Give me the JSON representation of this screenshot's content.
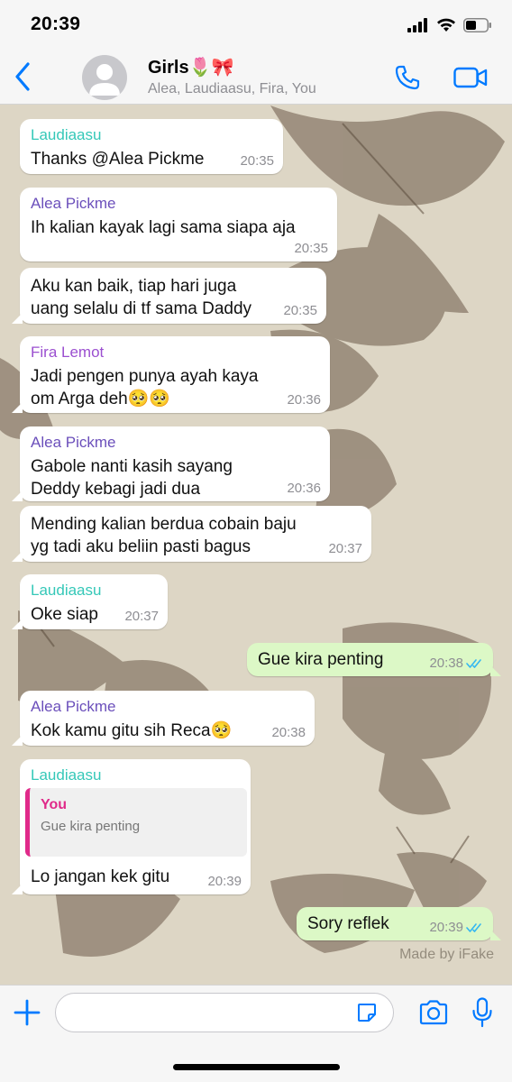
{
  "status_bar": {
    "time": "20:39"
  },
  "header": {
    "title": "Girls🌷🎀",
    "participants": "Alea, Laudiaasu, Fira, You"
  },
  "colors": {
    "accent": "#007aff",
    "sender_laudiaasu": "#35c8b8",
    "sender_alea": "#6b4fbb",
    "sender_fira": "#9b4fd0",
    "quote_author": "#e02a8a",
    "outgoing_bubble": "#dcf8c6",
    "incoming_bubble": "#ffffff",
    "read_ticks": "#34b7f1",
    "wallpaper": "#ddd6c5"
  },
  "messages": [
    {
      "sender": "Laudiaasu",
      "text": "Thanks @Alea Pickme",
      "time": "20:35"
    },
    {
      "sender": "Alea Pickme",
      "text": "Ih kalian kayak lagi sama siapa aja",
      "time": "20:35"
    },
    {
      "text": "Aku kan baik, tiap hari juga uang selalu di tf sama Daddy",
      "time": "20:35"
    },
    {
      "sender": "Fira Lemot",
      "text": "Jadi pengen punya ayah kaya om Arga deh🥺🥺",
      "time": "20:36"
    },
    {
      "sender": "Alea Pickme",
      "text": "Gabole nanti kasih sayang Deddy kebagi jadi dua",
      "time": "20:36"
    },
    {
      "text": "Mending kalian berdua cobain baju yg tadi aku beliin pasti bagus",
      "time": "20:37"
    },
    {
      "sender": "Laudiaasu",
      "text": "Oke siap",
      "time": "20:37"
    },
    {
      "text": "Gue kira penting",
      "time": "20:38",
      "status_icon": "double-check-icon"
    },
    {
      "sender": "Alea Pickme",
      "text": "Kok kamu gitu sih Reca🥺",
      "time": "20:38"
    },
    {
      "sender": "Laudiaasu",
      "quote": {
        "author": "You",
        "text": "Gue kira penting"
      },
      "text": "Lo jangan kek gitu",
      "time": "20:39"
    },
    {
      "text": "Sory reflek",
      "time": "20:39",
      "status_icon": "double-check-icon"
    }
  ],
  "watermark": "Made by iFake",
  "input": {
    "placeholder": ""
  },
  "icons": [
    "back-chevron-icon",
    "phone-icon",
    "video-camera-icon",
    "plus-icon",
    "sticker-icon",
    "camera-icon",
    "microphone-icon"
  ]
}
